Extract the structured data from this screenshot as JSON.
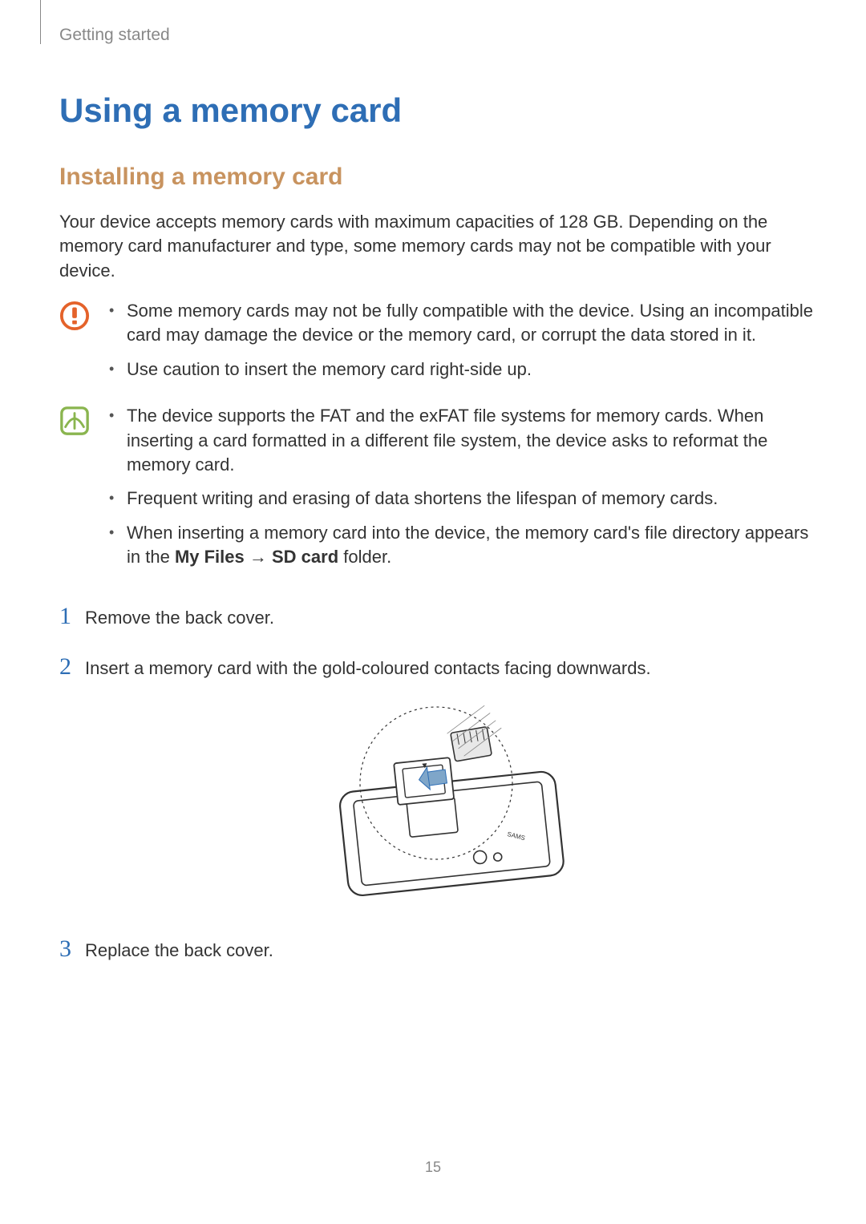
{
  "breadcrumb": "Getting started",
  "heading_main": "Using a memory card",
  "heading_sub": "Installing a memory card",
  "intro_paragraph": "Your device accepts memory cards with maximum capacities of 128 GB. Depending on the memory card manufacturer and type, some memory cards may not be compatible with your device.",
  "caution": {
    "bullets": [
      "Some memory cards may not be fully compatible with the device. Using an incompatible card may damage the device or the memory card, or corrupt the data stored in it.",
      "Use caution to insert the memory card right-side up."
    ]
  },
  "note": {
    "bullets": [
      "The device supports the FAT and the exFAT file systems for memory cards. When inserting a card formatted in a different file system, the device asks to reformat the memory card.",
      "Frequent writing and erasing of data shortens the lifespan of memory cards."
    ],
    "bullet3_prefix": "When inserting a memory card into the device, the memory card's file directory appears in the ",
    "bullet3_bold1": "My Files",
    "bullet3_arrow": " → ",
    "bullet3_bold2": "SD card",
    "bullet3_suffix": " folder."
  },
  "steps": [
    {
      "num": "1",
      "text": "Remove the back cover."
    },
    {
      "num": "2",
      "text": "Insert a memory card with the gold-coloured contacts facing downwards."
    },
    {
      "num": "3",
      "text": "Replace the back cover."
    }
  ],
  "page_number": "15",
  "icons": {
    "caution_color": "#e4622a",
    "note_color": "#8ab54f"
  }
}
